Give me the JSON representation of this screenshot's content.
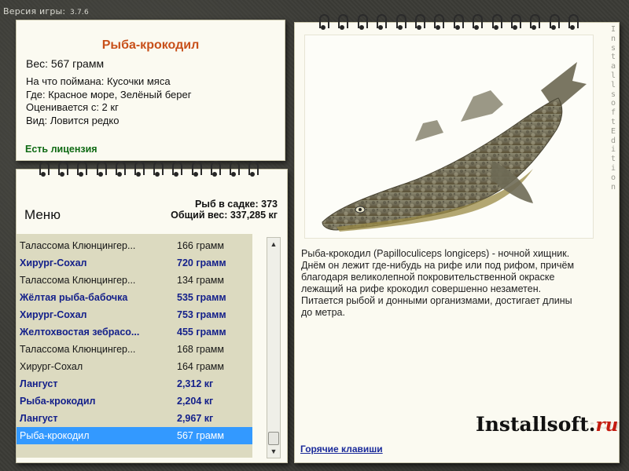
{
  "version": {
    "label": "Версия игры:",
    "number": "3.7.6"
  },
  "info": {
    "title": "Рыба-крокодил",
    "weight": "Вес: 567 грамм",
    "bait": "На что поймана: Кусочки мяса",
    "location": "Где: Красное море, Зелёный берег",
    "value": "Оценивается с: 2 кг",
    "rarity": "Вид: Ловится редко",
    "license": "Есть лицензия"
  },
  "menu": {
    "title": "Меню",
    "fish_count": "Рыб в садке: 373",
    "total_weight": "Общий вес: 337,285 кг"
  },
  "catch_list": [
    {
      "name": "Талассома Клюнцингер...",
      "weight": "166 грамм",
      "style": "norm"
    },
    {
      "name": "Хирург-Сохал",
      "weight": "720 грамм",
      "style": "bold"
    },
    {
      "name": "Талассома Клюнцингер...",
      "weight": "134 грамм",
      "style": "norm"
    },
    {
      "name": "Жёлтая рыба-бабочка",
      "weight": "535 грамм",
      "style": "bold"
    },
    {
      "name": "Хирург-Сохал",
      "weight": "753 грамм",
      "style": "bold"
    },
    {
      "name": "Желтохвостая зебрасо...",
      "weight": "455 грамм",
      "style": "bold"
    },
    {
      "name": "Талассома Клюнцингер...",
      "weight": "168 грамм",
      "style": "norm"
    },
    {
      "name": "Хирург-Сохал",
      "weight": "164 грамм",
      "style": "norm"
    },
    {
      "name": "Лангуст",
      "weight": "2,312 кг",
      "style": "bold"
    },
    {
      "name": "Рыба-крокодил",
      "weight": "2,204 кг",
      "style": "bold"
    },
    {
      "name": "Лангуст",
      "weight": "2,967 кг",
      "style": "bold"
    },
    {
      "name": "Рыба-крокодил",
      "weight": "567 грамм",
      "style": "sel"
    }
  ],
  "detail": {
    "description": "Рыба-крокодил (Papilloculiceps longiceps) - ночной хищник. Днём он лежит где-нибудь на рифе или под рифом, причём благодаря великолепной покровительственной окраске лежащий на рифе крокодил совершенно незаметен. Питается рыбой и донными организмами, достигает длины до метра.",
    "hotkeys": "Горячие клавиши",
    "brand_main": "Installsoft.",
    "brand_ru": "ru",
    "edition": "InstallsoftEdition"
  },
  "icons": {
    "scroll_up": "chevron-up-icon",
    "scroll_down": "chevron-down-icon"
  }
}
